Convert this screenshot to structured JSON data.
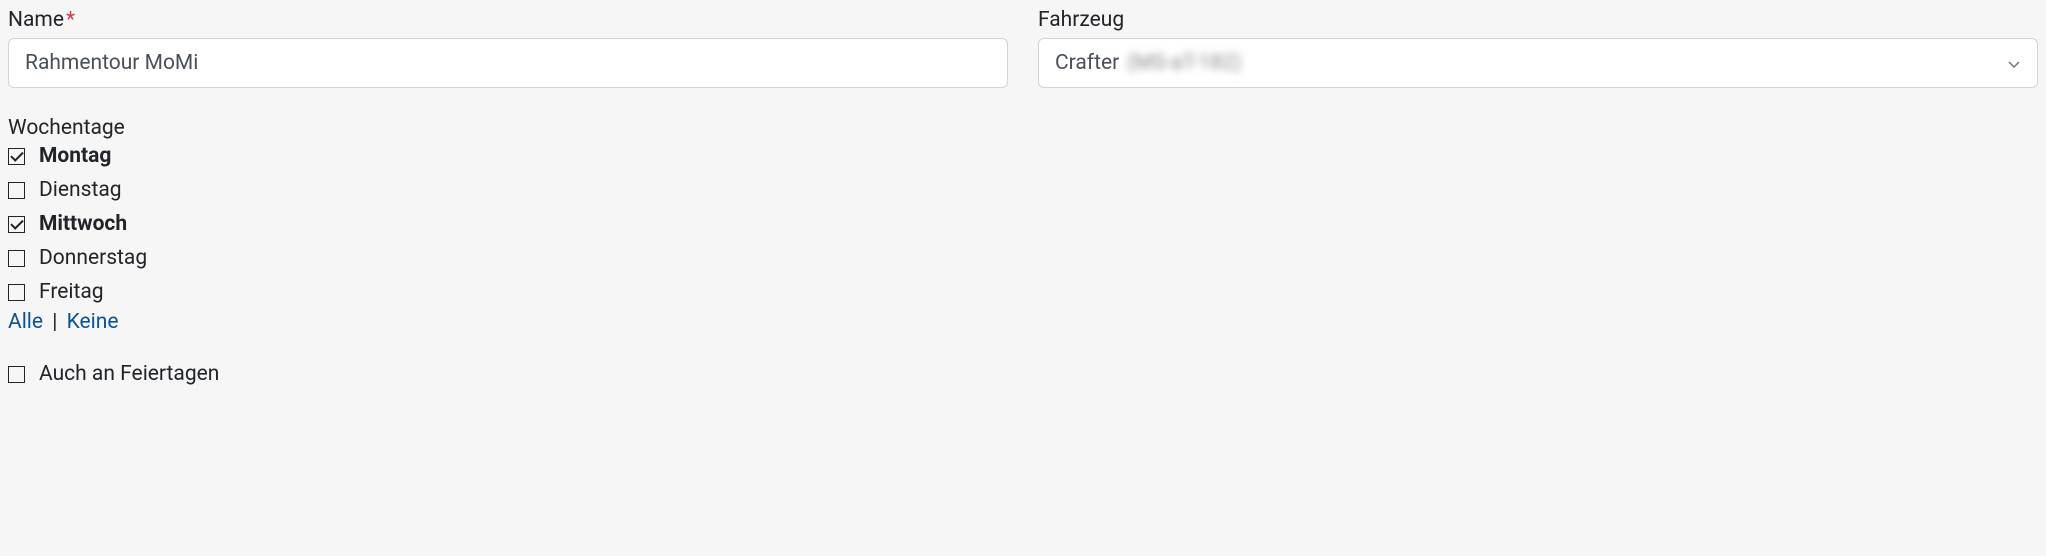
{
  "fields": {
    "name": {
      "label": "Name",
      "required": true,
      "value": "Rahmentour MoMi"
    },
    "vehicle": {
      "label": "Fahrzeug",
      "selected_prefix": "Crafter",
      "selected_blur": "(MS-aT-182)"
    }
  },
  "weekdays": {
    "label": "Wochentage",
    "days": [
      {
        "label": "Montag",
        "checked": true
      },
      {
        "label": "Dienstag",
        "checked": false
      },
      {
        "label": "Mittwoch",
        "checked": true
      },
      {
        "label": "Donnerstag",
        "checked": false
      },
      {
        "label": "Freitag",
        "checked": false
      }
    ],
    "all_label": "Alle",
    "none_label": "Keine",
    "separator": "|"
  },
  "holidays": {
    "label": "Auch an Feiertagen",
    "checked": false
  }
}
